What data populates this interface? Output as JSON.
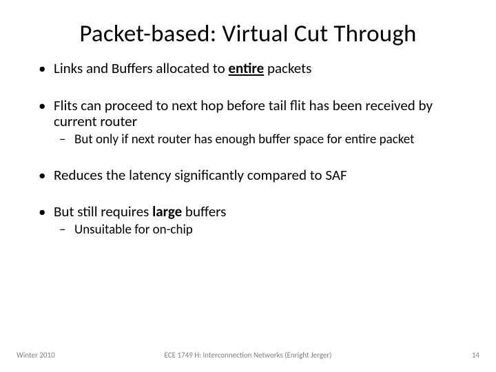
{
  "title": "Packet-based: Virtual Cut Through",
  "bullets": {
    "b1_pre": "Links and Buffers allocated to ",
    "b1_entire": "entire",
    "b1_post": " packets",
    "b2": "Flits can proceed to next hop before tail flit has been received by current router",
    "b2_sub": "But only if next router has enough buffer space for entire packet",
    "b3": "Reduces the latency significantly compared to SAF",
    "b4_pre": "But still requires ",
    "b4_large": "large",
    "b4_post": " buffers",
    "b4_sub": "Unsuitable for on-chip"
  },
  "footer": {
    "left": "Winter 2010",
    "center": "ECE 1749 H: Interconnection Networks (Enright Jerger)",
    "right": "14"
  }
}
